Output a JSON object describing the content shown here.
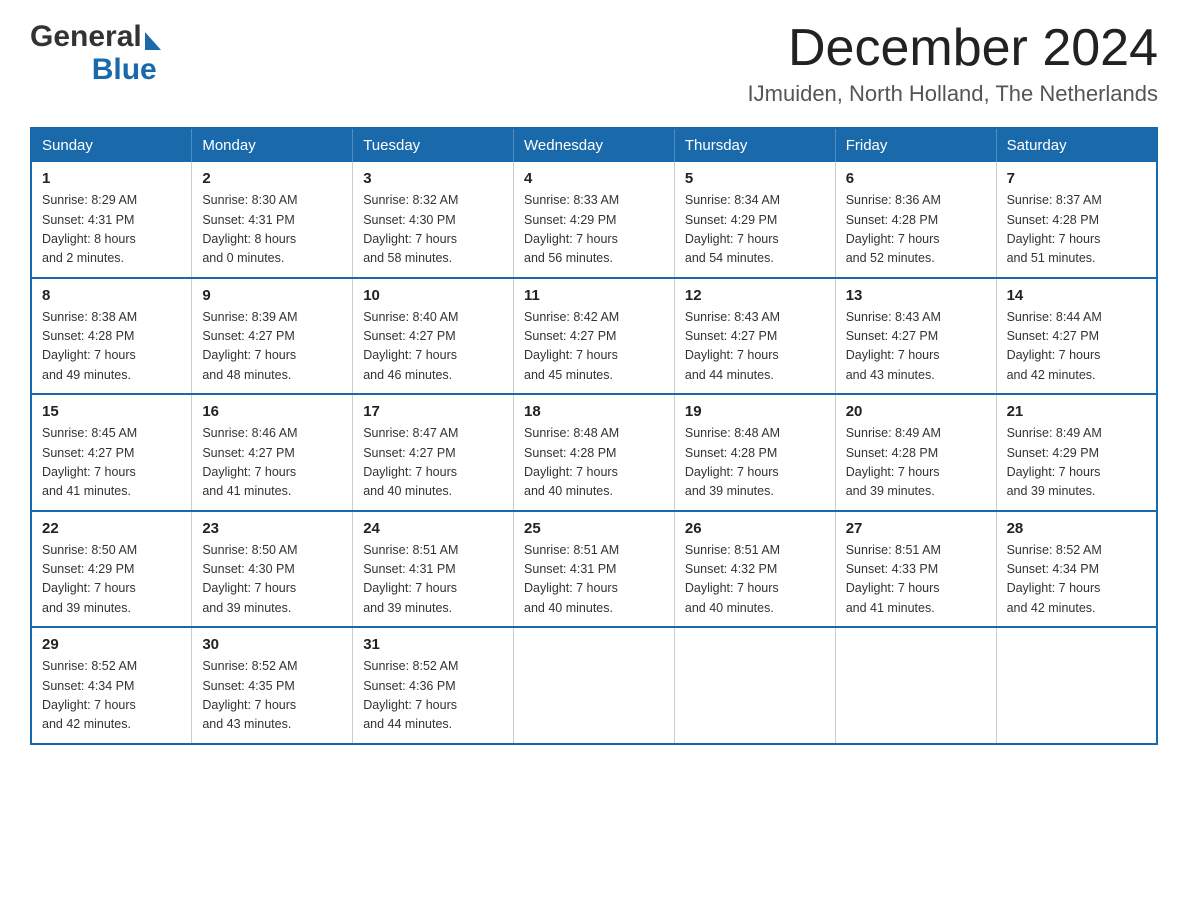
{
  "header": {
    "logo_general": "General",
    "logo_blue": "Blue",
    "month_year": "December 2024",
    "location": "IJmuiden, North Holland, The Netherlands"
  },
  "weekdays": [
    "Sunday",
    "Monday",
    "Tuesday",
    "Wednesday",
    "Thursday",
    "Friday",
    "Saturday"
  ],
  "weeks": [
    [
      {
        "day": "1",
        "info": "Sunrise: 8:29 AM\nSunset: 4:31 PM\nDaylight: 8 hours\nand 2 minutes."
      },
      {
        "day": "2",
        "info": "Sunrise: 8:30 AM\nSunset: 4:31 PM\nDaylight: 8 hours\nand 0 minutes."
      },
      {
        "day": "3",
        "info": "Sunrise: 8:32 AM\nSunset: 4:30 PM\nDaylight: 7 hours\nand 58 minutes."
      },
      {
        "day": "4",
        "info": "Sunrise: 8:33 AM\nSunset: 4:29 PM\nDaylight: 7 hours\nand 56 minutes."
      },
      {
        "day": "5",
        "info": "Sunrise: 8:34 AM\nSunset: 4:29 PM\nDaylight: 7 hours\nand 54 minutes."
      },
      {
        "day": "6",
        "info": "Sunrise: 8:36 AM\nSunset: 4:28 PM\nDaylight: 7 hours\nand 52 minutes."
      },
      {
        "day": "7",
        "info": "Sunrise: 8:37 AM\nSunset: 4:28 PM\nDaylight: 7 hours\nand 51 minutes."
      }
    ],
    [
      {
        "day": "8",
        "info": "Sunrise: 8:38 AM\nSunset: 4:28 PM\nDaylight: 7 hours\nand 49 minutes."
      },
      {
        "day": "9",
        "info": "Sunrise: 8:39 AM\nSunset: 4:27 PM\nDaylight: 7 hours\nand 48 minutes."
      },
      {
        "day": "10",
        "info": "Sunrise: 8:40 AM\nSunset: 4:27 PM\nDaylight: 7 hours\nand 46 minutes."
      },
      {
        "day": "11",
        "info": "Sunrise: 8:42 AM\nSunset: 4:27 PM\nDaylight: 7 hours\nand 45 minutes."
      },
      {
        "day": "12",
        "info": "Sunrise: 8:43 AM\nSunset: 4:27 PM\nDaylight: 7 hours\nand 44 minutes."
      },
      {
        "day": "13",
        "info": "Sunrise: 8:43 AM\nSunset: 4:27 PM\nDaylight: 7 hours\nand 43 minutes."
      },
      {
        "day": "14",
        "info": "Sunrise: 8:44 AM\nSunset: 4:27 PM\nDaylight: 7 hours\nand 42 minutes."
      }
    ],
    [
      {
        "day": "15",
        "info": "Sunrise: 8:45 AM\nSunset: 4:27 PM\nDaylight: 7 hours\nand 41 minutes."
      },
      {
        "day": "16",
        "info": "Sunrise: 8:46 AM\nSunset: 4:27 PM\nDaylight: 7 hours\nand 41 minutes."
      },
      {
        "day": "17",
        "info": "Sunrise: 8:47 AM\nSunset: 4:27 PM\nDaylight: 7 hours\nand 40 minutes."
      },
      {
        "day": "18",
        "info": "Sunrise: 8:48 AM\nSunset: 4:28 PM\nDaylight: 7 hours\nand 40 minutes."
      },
      {
        "day": "19",
        "info": "Sunrise: 8:48 AM\nSunset: 4:28 PM\nDaylight: 7 hours\nand 39 minutes."
      },
      {
        "day": "20",
        "info": "Sunrise: 8:49 AM\nSunset: 4:28 PM\nDaylight: 7 hours\nand 39 minutes."
      },
      {
        "day": "21",
        "info": "Sunrise: 8:49 AM\nSunset: 4:29 PM\nDaylight: 7 hours\nand 39 minutes."
      }
    ],
    [
      {
        "day": "22",
        "info": "Sunrise: 8:50 AM\nSunset: 4:29 PM\nDaylight: 7 hours\nand 39 minutes."
      },
      {
        "day": "23",
        "info": "Sunrise: 8:50 AM\nSunset: 4:30 PM\nDaylight: 7 hours\nand 39 minutes."
      },
      {
        "day": "24",
        "info": "Sunrise: 8:51 AM\nSunset: 4:31 PM\nDaylight: 7 hours\nand 39 minutes."
      },
      {
        "day": "25",
        "info": "Sunrise: 8:51 AM\nSunset: 4:31 PM\nDaylight: 7 hours\nand 40 minutes."
      },
      {
        "day": "26",
        "info": "Sunrise: 8:51 AM\nSunset: 4:32 PM\nDaylight: 7 hours\nand 40 minutes."
      },
      {
        "day": "27",
        "info": "Sunrise: 8:51 AM\nSunset: 4:33 PM\nDaylight: 7 hours\nand 41 minutes."
      },
      {
        "day": "28",
        "info": "Sunrise: 8:52 AM\nSunset: 4:34 PM\nDaylight: 7 hours\nand 42 minutes."
      }
    ],
    [
      {
        "day": "29",
        "info": "Sunrise: 8:52 AM\nSunset: 4:34 PM\nDaylight: 7 hours\nand 42 minutes."
      },
      {
        "day": "30",
        "info": "Sunrise: 8:52 AM\nSunset: 4:35 PM\nDaylight: 7 hours\nand 43 minutes."
      },
      {
        "day": "31",
        "info": "Sunrise: 8:52 AM\nSunset: 4:36 PM\nDaylight: 7 hours\nand 44 minutes."
      },
      {
        "day": "",
        "info": ""
      },
      {
        "day": "",
        "info": ""
      },
      {
        "day": "",
        "info": ""
      },
      {
        "day": "",
        "info": ""
      }
    ]
  ]
}
